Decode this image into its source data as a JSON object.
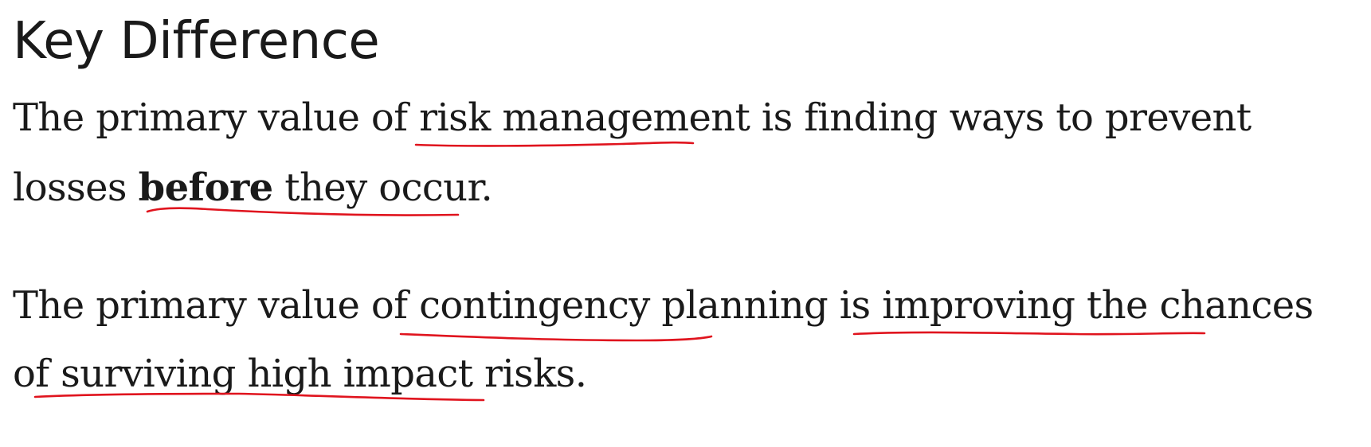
{
  "heading": "Key Difference",
  "paragraph1": {
    "line1": {
      "pre": "The primary value of ",
      "term": "risk management",
      "post": " is finding ways to prevent"
    },
    "line2": {
      "pre": "losses ",
      "bold": "before",
      "post": " they occur."
    }
  },
  "paragraph2": {
    "line1": {
      "pre": "The primary value of ",
      "term": "contingency planning",
      "mid": " is ",
      "phrase": "improving the chances"
    },
    "line2": {
      "pre": "of ",
      "phrase": "surviving high impact risks",
      "post": "."
    }
  },
  "annotation_color": "#e0141e"
}
